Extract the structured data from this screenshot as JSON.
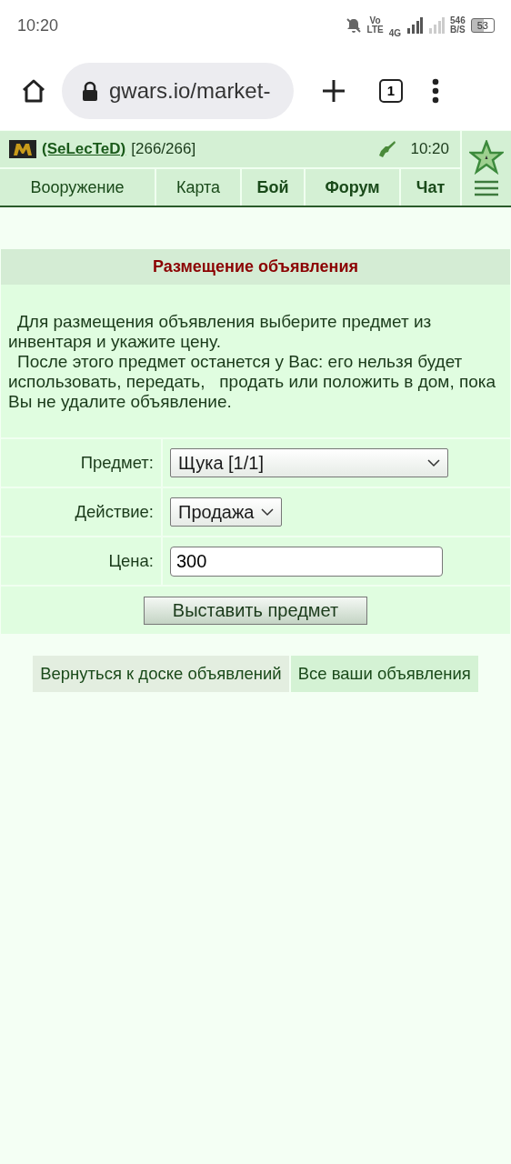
{
  "status_bar": {
    "time": "10:20",
    "volte": [
      "Vo",
      "LTE"
    ],
    "network": "4G",
    "speed": [
      "546",
      "B/S"
    ],
    "battery": "53"
  },
  "browser": {
    "url": "gwars.io/market-",
    "tab_count": "1"
  },
  "header": {
    "player": "(SeLecTeD)",
    "hp": "[266/266]",
    "time": "10:20"
  },
  "nav": [
    {
      "label": "Вооружение",
      "bold": false
    },
    {
      "label": "Карта",
      "bold": false
    },
    {
      "label": "Бой",
      "bold": true
    },
    {
      "label": "Форум",
      "bold": true
    },
    {
      "label": "Чат",
      "bold": true
    }
  ],
  "panel": {
    "title": "Размещение объявления",
    "paragraphs": [
      "Для размещения объявления выберите предмет из инвентаря и укажите цену.",
      "После этого предмет останется у Вас: его нельзя будет использовать, передать,   продать или положить в дом, пока Вы не удалите объявление."
    ],
    "fields": [
      {
        "label": "Предмет:",
        "kind": "select",
        "value": "Щука [1/1]",
        "wide": true
      },
      {
        "label": "Действие:",
        "kind": "select",
        "value": "Продажа",
        "wide": false
      },
      {
        "label": "Цена:",
        "kind": "input",
        "value": "300",
        "wide": true
      }
    ],
    "submit": "Выставить предмет"
  },
  "links": [
    {
      "label": "Вернуться к доске объявлений",
      "color": "#e3eee0"
    },
    {
      "label": "Все ваши объявления",
      "color": "#d4f2d4"
    }
  ]
}
